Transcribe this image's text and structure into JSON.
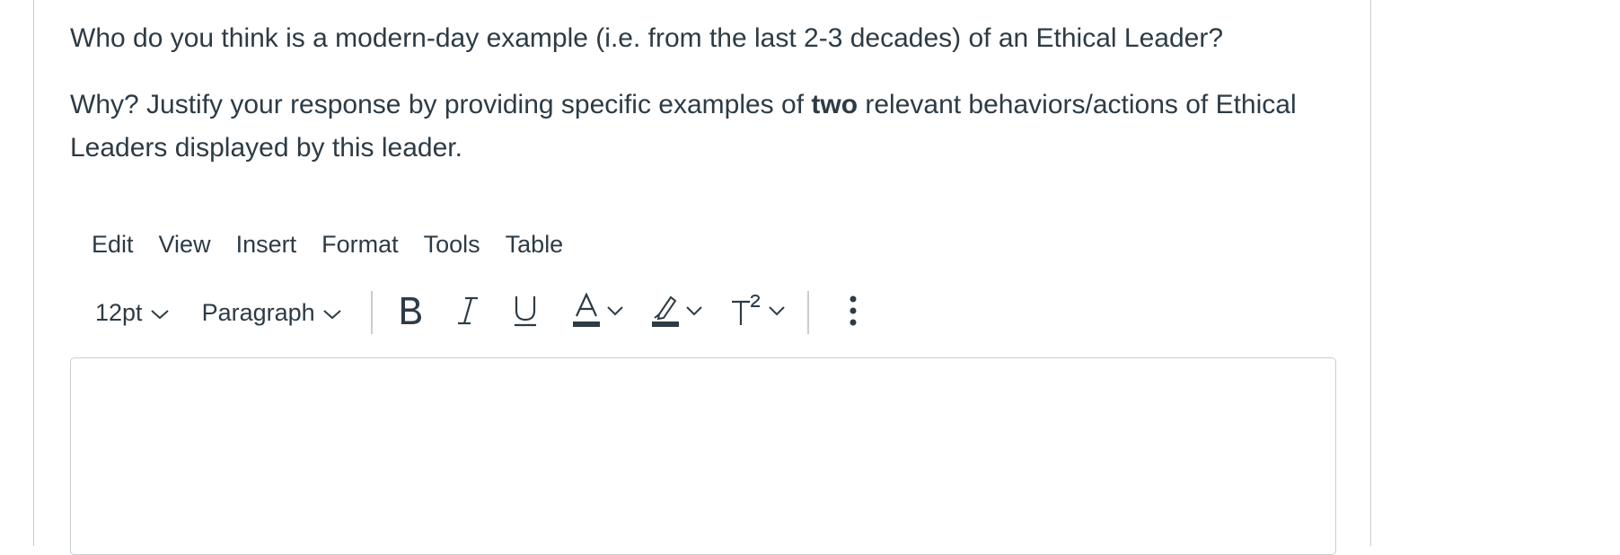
{
  "question": {
    "line1": "Who do you think is a modern-day example (i.e. from the last 2-3 decades) of an Ethical Leader?",
    "line2_before": "Why? Justify your response by providing specific examples of ",
    "line2_bold": "two",
    "line2_after": " relevant behaviors/actions of Ethical Leaders displayed by this leader."
  },
  "menubar": {
    "items": [
      "Edit",
      "View",
      "Insert",
      "Format",
      "Tools",
      "Table"
    ]
  },
  "toolbar": {
    "font_size": "12pt",
    "block_format": "Paragraph",
    "icons": {
      "bold": "bold-icon",
      "italic": "italic-icon",
      "underline": "underline-icon",
      "text_color": "text-color-icon",
      "highlight": "highlight-icon",
      "superscript": "superscript-icon",
      "more": "more-vertical-icon"
    }
  },
  "editor": {
    "content": ""
  },
  "colors": {
    "text": "#2d3b45",
    "border": "#c7cdd1"
  }
}
